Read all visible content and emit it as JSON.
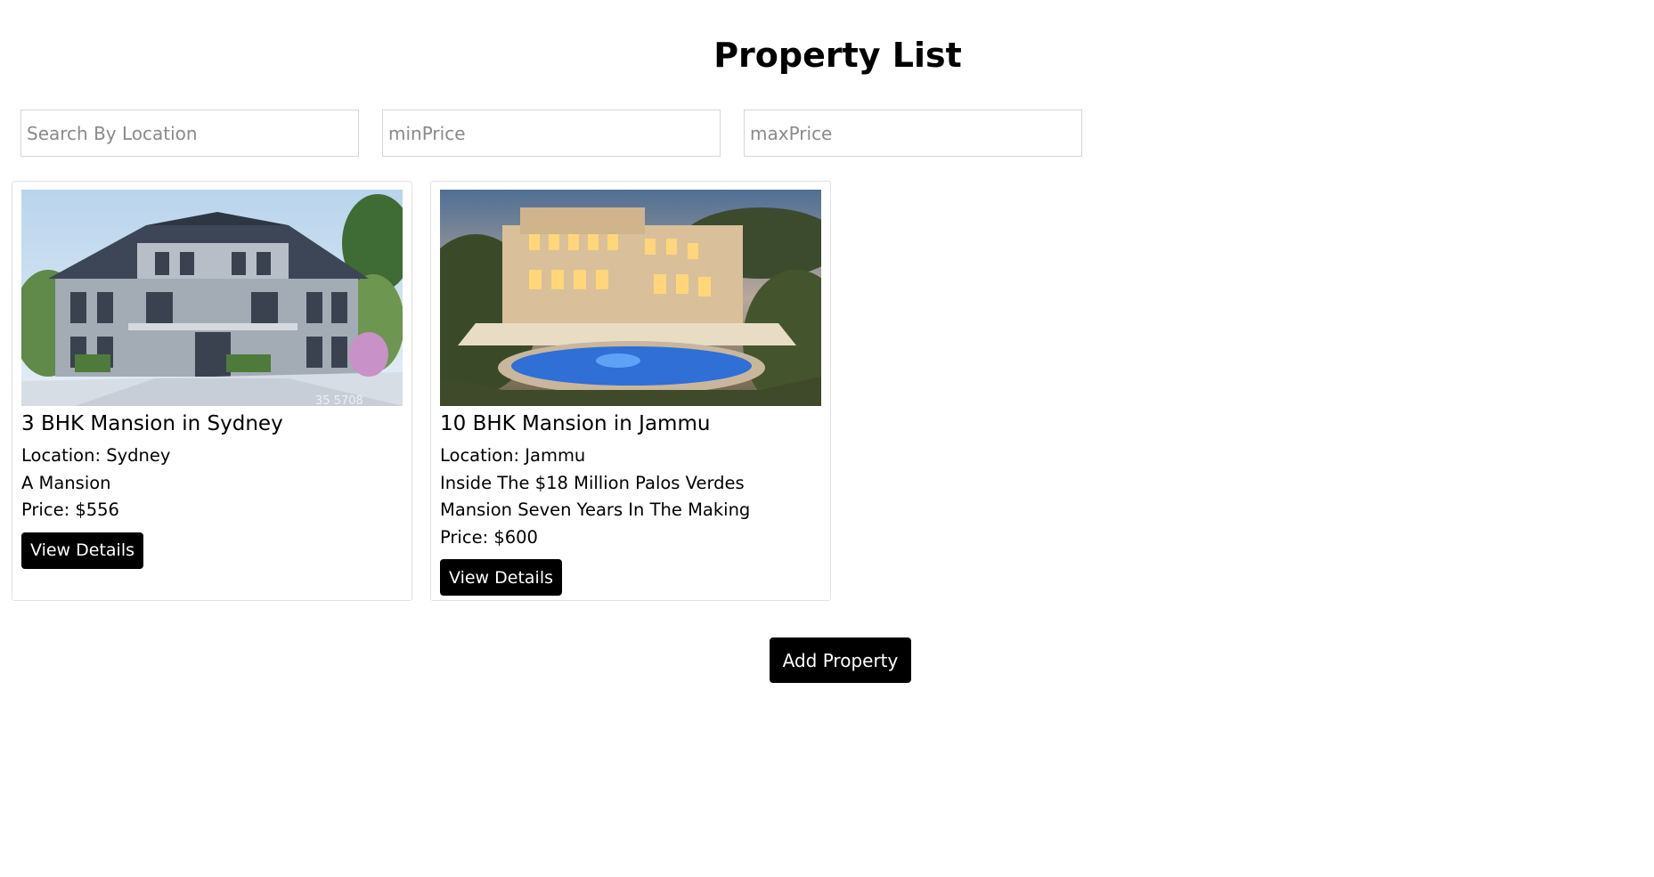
{
  "header": {
    "title": "Property List"
  },
  "filters": {
    "location_placeholder": "Search By Location",
    "min_price_placeholder": "minPrice",
    "max_price_placeholder": "maxPrice"
  },
  "properties": [
    {
      "title": "3 BHK Mansion in Sydney",
      "location": "Location: Sydney",
      "description": "A Mansion",
      "price": "Price: $556",
      "button_label": "View Details",
      "image_watermark": "35 5708"
    },
    {
      "title": "10 BHK Mansion in Jammu",
      "location": "Location: Jammu",
      "description": "Inside The $18 Million Palos Verdes Mansion Seven Years In The Making",
      "price": "Price: $600",
      "button_label": "View Details"
    }
  ],
  "footer": {
    "add_label": "Add Property"
  },
  "colors": {
    "button_bg": "#000000",
    "button_text": "#ffffff",
    "border": "#e2e2e2"
  }
}
